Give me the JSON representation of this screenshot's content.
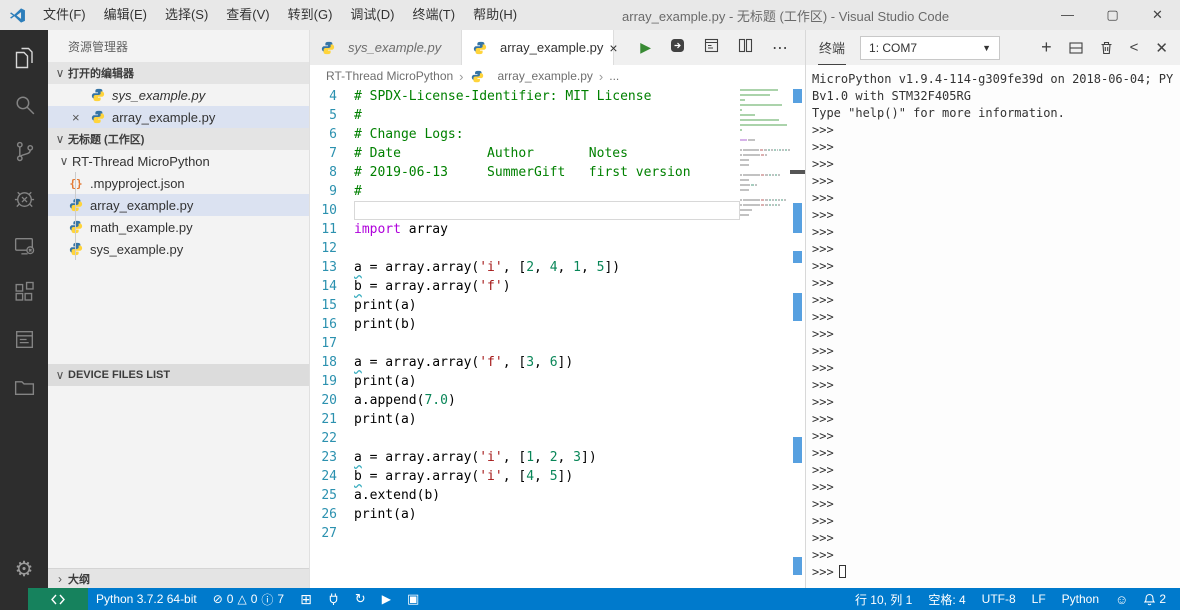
{
  "window": {
    "title": "array_example.py - 无标题 (工作区) - Visual Studio Code",
    "menus": [
      "文件(F)",
      "编辑(E)",
      "选择(S)",
      "查看(V)",
      "转到(G)",
      "调试(D)",
      "终端(T)",
      "帮助(H)"
    ]
  },
  "activity_bar": {
    "items": [
      "explorer",
      "search",
      "source-control",
      "debug",
      "device",
      "extensions",
      "output",
      "folder"
    ],
    "bottom": "settings"
  },
  "sidebar": {
    "title": "资源管理器",
    "open_editors": {
      "label": "打开的编辑器",
      "items": [
        {
          "label": "sys_example.py",
          "preview": true,
          "selected": false,
          "show_close": false
        },
        {
          "label": "array_example.py",
          "preview": false,
          "selected": true,
          "show_close": true
        }
      ]
    },
    "workspace": {
      "label": "无标题 (工作区)",
      "folder": "RT-Thread MicroPython",
      "files": [
        {
          "label": ".mpyproject.json",
          "icon": "json",
          "selected": false
        },
        {
          "label": "array_example.py",
          "icon": "python",
          "selected": true
        },
        {
          "label": "math_example.py",
          "icon": "python",
          "selected": false
        },
        {
          "label": "sys_example.py",
          "icon": "python",
          "selected": false
        }
      ]
    },
    "device_files_label": "DEVICE FILES LIST",
    "outline_label": "大纲"
  },
  "editor": {
    "tabs": [
      {
        "label": "sys_example.py",
        "active": false
      },
      {
        "label": "array_example.py",
        "active": true
      }
    ],
    "actions": [
      "run",
      "sync-device",
      "open-changes",
      "split-editor",
      "more"
    ],
    "breadcrumb": {
      "items": [
        "RT-Thread MicroPython",
        "array_example.py",
        "..."
      ]
    },
    "code": {
      "cursor_line": 10,
      "lines": [
        {
          "n": 4,
          "seg": [
            [
              "c",
              "# SPDX-License-Identifier: MIT License"
            ]
          ]
        },
        {
          "n": 5,
          "seg": [
            [
              "c",
              "#"
            ]
          ]
        },
        {
          "n": 6,
          "seg": [
            [
              "c",
              "# Change Logs:"
            ]
          ]
        },
        {
          "n": 7,
          "seg": [
            [
              "c",
              "# Date           Author       Notes"
            ]
          ]
        },
        {
          "n": 8,
          "seg": [
            [
              "c",
              "# 2019-06-13     SummerGift   first version"
            ]
          ]
        },
        {
          "n": 9,
          "seg": [
            [
              "c",
              "#"
            ]
          ]
        },
        {
          "n": 10,
          "seg": []
        },
        {
          "n": 11,
          "seg": [
            [
              "k",
              "import"
            ],
            [
              "p",
              " array"
            ]
          ]
        },
        {
          "n": 12,
          "seg": []
        },
        {
          "n": 13,
          "seg": [
            [
              "u",
              "a"
            ],
            [
              "p",
              " = array.array("
            ],
            [
              "s",
              "'i'"
            ],
            [
              "p",
              ", ["
            ],
            [
              "m",
              "2"
            ],
            [
              "p",
              ", "
            ],
            [
              "m",
              "4"
            ],
            [
              "p",
              ", "
            ],
            [
              "m",
              "1"
            ],
            [
              "p",
              ", "
            ],
            [
              "m",
              "5"
            ],
            [
              "p",
              "])"
            ]
          ]
        },
        {
          "n": 14,
          "seg": [
            [
              "u",
              "b"
            ],
            [
              "p",
              " = array.array("
            ],
            [
              "s",
              "'f'"
            ],
            [
              "p",
              ")"
            ]
          ]
        },
        {
          "n": 15,
          "seg": [
            [
              "p",
              "print(a)"
            ]
          ]
        },
        {
          "n": 16,
          "seg": [
            [
              "p",
              "print(b)"
            ]
          ]
        },
        {
          "n": 17,
          "seg": []
        },
        {
          "n": 18,
          "seg": [
            [
              "u",
              "a"
            ],
            [
              "p",
              " = array.array("
            ],
            [
              "s",
              "'f'"
            ],
            [
              "p",
              ", ["
            ],
            [
              "m",
              "3"
            ],
            [
              "p",
              ", "
            ],
            [
              "m",
              "6"
            ],
            [
              "p",
              "])"
            ]
          ]
        },
        {
          "n": 19,
          "seg": [
            [
              "p",
              "print(a)"
            ]
          ]
        },
        {
          "n": 20,
          "seg": [
            [
              "p",
              "a.append("
            ],
            [
              "m",
              "7.0"
            ],
            [
              "p",
              ")"
            ]
          ]
        },
        {
          "n": 21,
          "seg": [
            [
              "p",
              "print(a)"
            ]
          ]
        },
        {
          "n": 22,
          "seg": []
        },
        {
          "n": 23,
          "seg": [
            [
              "u",
              "a"
            ],
            [
              "p",
              " = array.array("
            ],
            [
              "s",
              "'i'"
            ],
            [
              "p",
              ", ["
            ],
            [
              "m",
              "1"
            ],
            [
              "p",
              ", "
            ],
            [
              "m",
              "2"
            ],
            [
              "p",
              ", "
            ],
            [
              "m",
              "3"
            ],
            [
              "p",
              "])"
            ]
          ]
        },
        {
          "n": 24,
          "seg": [
            [
              "u",
              "b"
            ],
            [
              "p",
              " = array.array("
            ],
            [
              "s",
              "'i'"
            ],
            [
              "p",
              ", ["
            ],
            [
              "m",
              "4"
            ],
            [
              "p",
              ", "
            ],
            [
              "m",
              "5"
            ],
            [
              "p",
              "])"
            ]
          ]
        },
        {
          "n": 25,
          "seg": [
            [
              "p",
              "a.extend(b)"
            ]
          ]
        },
        {
          "n": 26,
          "seg": [
            [
              "p",
              "print(a)"
            ]
          ]
        },
        {
          "n": 27,
          "seg": []
        }
      ]
    }
  },
  "terminal_panel": {
    "tab_label": "终端",
    "selector_value": "1: COM7",
    "output": [
      "MicroPython v1.9.4-114-g309fe39d on 2018-06-04; PY",
      "Bv1.0 with STM32F405RG",
      "Type \"help()\" for more information."
    ],
    "prompt": ">>>",
    "prompt_count": 27
  },
  "status_bar": {
    "left": {
      "python_version": "Python 3.7.2 64-bit",
      "errors": "0",
      "warnings": "0",
      "infos": "7"
    },
    "right": {
      "cursor": "行 10, 列 1",
      "indent": "空格: 4",
      "encoding": "UTF-8",
      "eol": "LF",
      "language": "Python",
      "notifications": "2"
    }
  },
  "colors": {
    "accent": "#007ACC",
    "remote": "#16825D",
    "comment": "#008000",
    "keyword": "#AF00DB",
    "string": "#A31515",
    "number": "#098658",
    "selection": "#DBE2F1"
  }
}
